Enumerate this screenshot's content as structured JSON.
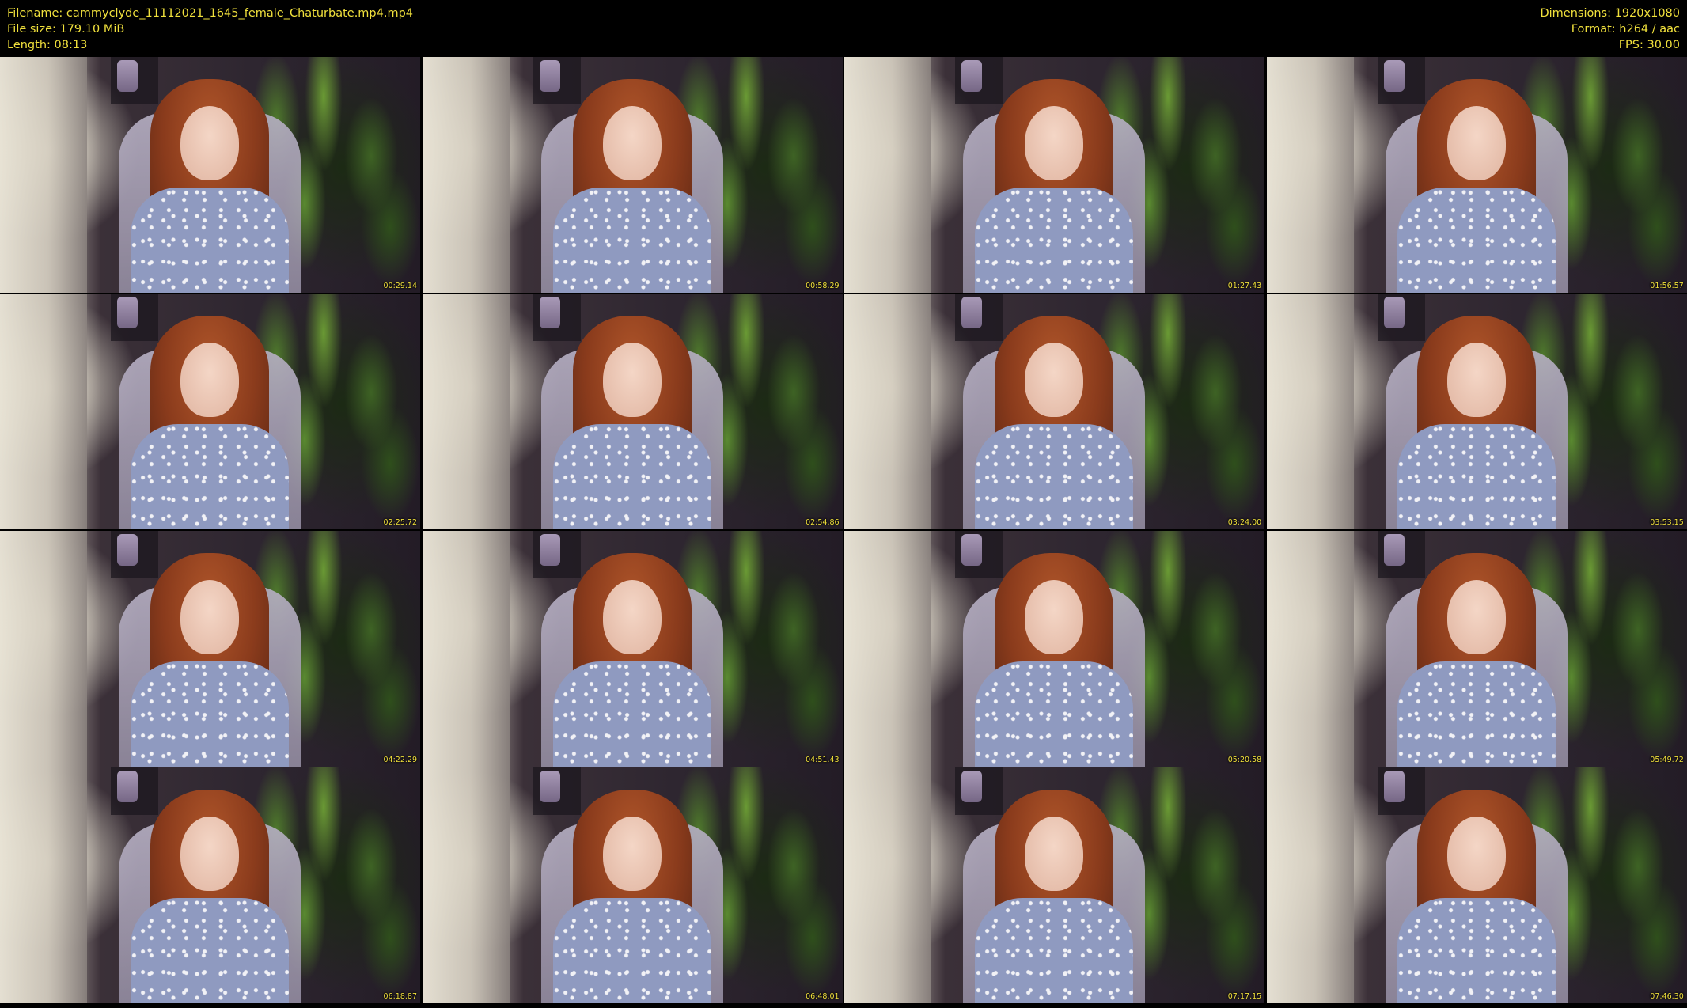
{
  "header": {
    "filename": "Filename: cammyclyde_11112021_1645_female_Chaturbate.mp4.mp4",
    "file_size": "File size: 179.10 MiB",
    "length": "Length: 08:13",
    "dimensions": "Dimensions: 1920x1080",
    "format": "Format: h264 / aac",
    "fps": "FPS: 30.00"
  },
  "thumbnails": [
    {
      "timestamp": "00:29.14"
    },
    {
      "timestamp": "00:58.29"
    },
    {
      "timestamp": "01:27.43"
    },
    {
      "timestamp": "01:56.57"
    },
    {
      "timestamp": "02:25.72"
    },
    {
      "timestamp": "02:54.86"
    },
    {
      "timestamp": "03:24.00"
    },
    {
      "timestamp": "03:53.15"
    },
    {
      "timestamp": "04:22.29"
    },
    {
      "timestamp": "04:51.43"
    },
    {
      "timestamp": "05:20.58"
    },
    {
      "timestamp": "05:49.72"
    },
    {
      "timestamp": "06:18.87"
    },
    {
      "timestamp": "06:48.01"
    },
    {
      "timestamp": "07:17.15"
    },
    {
      "timestamp": "07:46.30"
    }
  ],
  "colors": {
    "background": "#000000",
    "text": "#f0e03c"
  }
}
